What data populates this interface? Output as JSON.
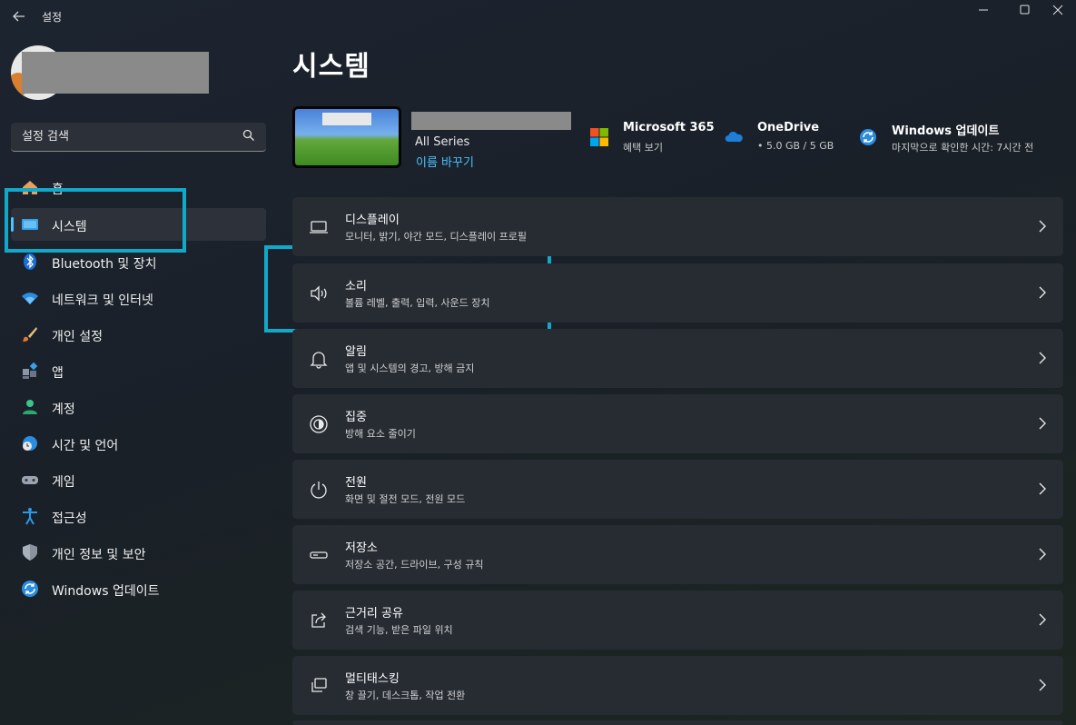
{
  "window": {
    "title": "설정",
    "back_icon": "arrow-left-icon",
    "controls": [
      "minimize-icon",
      "maximize-icon",
      "close-icon"
    ]
  },
  "sidebar": {
    "search_placeholder": "설정 검색",
    "items": [
      {
        "label": "홈",
        "icon": "home-icon"
      },
      {
        "label": "시스템",
        "icon": "system-icon",
        "selected": true
      },
      {
        "label": "Bluetooth 및 장치",
        "icon": "bluetooth-icon"
      },
      {
        "label": "네트워크 및 인터넷",
        "icon": "wifi-icon"
      },
      {
        "label": "개인 설정",
        "icon": "brush-icon"
      },
      {
        "label": "앱",
        "icon": "apps-icon"
      },
      {
        "label": "계정",
        "icon": "account-icon"
      },
      {
        "label": "시간 및 언어",
        "icon": "globe-clock-icon"
      },
      {
        "label": "게임",
        "icon": "gamepad-icon"
      },
      {
        "label": "접근성",
        "icon": "accessibility-icon"
      },
      {
        "label": "개인 정보 및 보안",
        "icon": "shield-icon"
      },
      {
        "label": "Windows 업데이트",
        "icon": "update-icon"
      }
    ]
  },
  "main": {
    "title": "시스템",
    "device": {
      "model": "All Series",
      "rename_link": "이름 바꾸기"
    },
    "services": [
      {
        "title": "Microsoft 365",
        "subtitle": "혜택 보기",
        "icon": "microsoft-logo-icon"
      },
      {
        "title": "OneDrive",
        "subtitle": "• 5.0 GB / 5 GB",
        "icon": "onedrive-cloud-icon"
      },
      {
        "title": "Windows 업데이트",
        "subtitle": "마지막으로 확인한 시간: 7시간 전",
        "icon": "update-icon"
      }
    ],
    "cards": [
      {
        "title": "디스플레이",
        "subtitle": "모니터, 밝기, 야간 모드, 디스플레이 프로필",
        "icon": "display-icon"
      },
      {
        "title": "소리",
        "subtitle": "볼륨 레벨, 출력, 입력, 사운드 장치",
        "icon": "speaker-icon"
      },
      {
        "title": "알림",
        "subtitle": "앱 및 시스템의 경고, 방해 금지",
        "icon": "bell-icon"
      },
      {
        "title": "집중",
        "subtitle": "방해 요소 줄이기",
        "icon": "focus-icon"
      },
      {
        "title": "전원",
        "subtitle": "화면 및 절전 모드, 전원 모드",
        "icon": "power-icon"
      },
      {
        "title": "저장소",
        "subtitle": "저장소 공간, 드라이브, 구성 규칙",
        "icon": "storage-icon"
      },
      {
        "title": "근거리 공유",
        "subtitle": "검색 기능, 받은 파일 위치",
        "icon": "share-icon"
      },
      {
        "title": "멀티태스킹",
        "subtitle": "창 끌기, 데스크톱, 작업 전환",
        "icon": "multitask-icon"
      }
    ]
  },
  "colors": {
    "accent": "#4cc2ff",
    "highlight_box": "#11a9c9",
    "card_bg": "#272c33"
  }
}
